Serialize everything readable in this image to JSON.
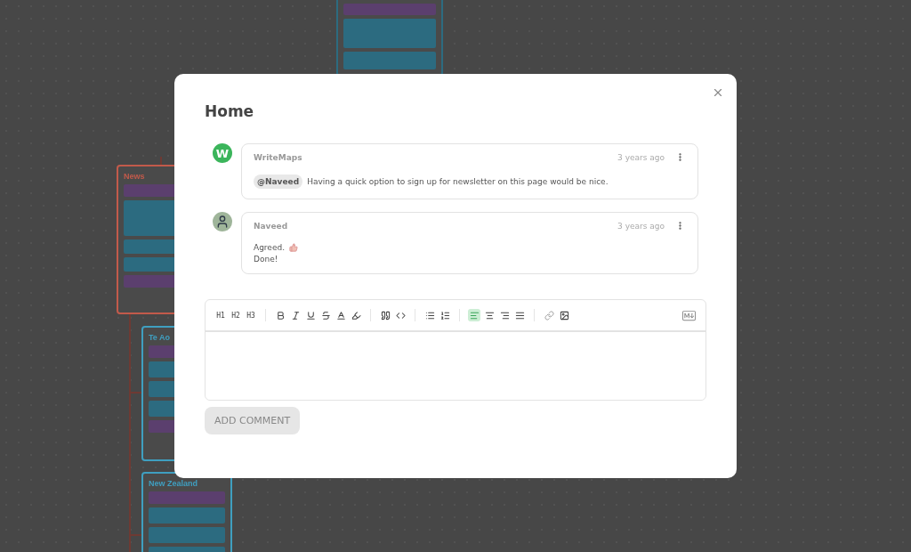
{
  "background": {
    "nodes": [
      {
        "title": "News",
        "color": "#c25a4b"
      },
      {
        "title": "Te Ao",
        "color": "#3f9fc0"
      },
      {
        "title": "New Zealand",
        "color": "#3f9fc0"
      }
    ]
  },
  "modal": {
    "title": "Home"
  },
  "comments": [
    {
      "author": "WriteMaps",
      "time": "3 years ago",
      "avatar": {
        "kind": "letter",
        "letter": "W"
      },
      "mention": "@Naveed",
      "lines": [
        {
          "text": "Having a quick option to sign up for newsletter on this page would be nice.",
          "thumb": false
        }
      ]
    },
    {
      "author": "Naveed",
      "time": "3 years ago",
      "avatar": {
        "kind": "photo"
      },
      "lines": [
        {
          "text": "Agreed.",
          "thumb": true
        },
        {
          "text": "Done!",
          "thumb": false
        }
      ]
    }
  ],
  "editor": {
    "headings": [
      "H1",
      "H2",
      "H3"
    ],
    "alignment": [
      {
        "selected": true
      },
      {
        "selected": false
      },
      {
        "selected": false
      },
      {
        "selected": false
      }
    ]
  },
  "submit": {
    "label": "ADD COMMENT",
    "disabled": true
  }
}
